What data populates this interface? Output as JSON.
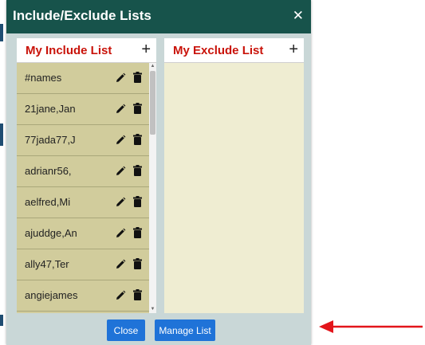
{
  "dialog": {
    "title": "Include/Exclude Lists",
    "close_glyph": "✕"
  },
  "include_panel": {
    "title": "My Include List",
    "add_glyph": "+",
    "items": [
      {
        "name": "#names"
      },
      {
        "name": "21jane,Jan"
      },
      {
        "name": "77jada77,J"
      },
      {
        "name": "adrianr56,"
      },
      {
        "name": "aelfred,Mi"
      },
      {
        "name": "ajuddge,An"
      },
      {
        "name": "ally47,Ter"
      },
      {
        "name": "angiejames"
      },
      {
        "name": ""
      }
    ]
  },
  "exclude_panel": {
    "title": "My Exclude List",
    "add_glyph": "+",
    "items": []
  },
  "footer": {
    "close_label": "Close",
    "manage_label": "Manage List"
  },
  "icons": {
    "edit": "pencil-icon",
    "delete": "trash-icon",
    "annotation": "red-arrow-icon"
  },
  "colors": {
    "title_bar": "#17534b",
    "panel_title": "#c9130a",
    "list_item": "#d1cc9c",
    "panel_bg": "#efedd2",
    "button": "#1f73d8",
    "arrow": "#e3151b"
  }
}
